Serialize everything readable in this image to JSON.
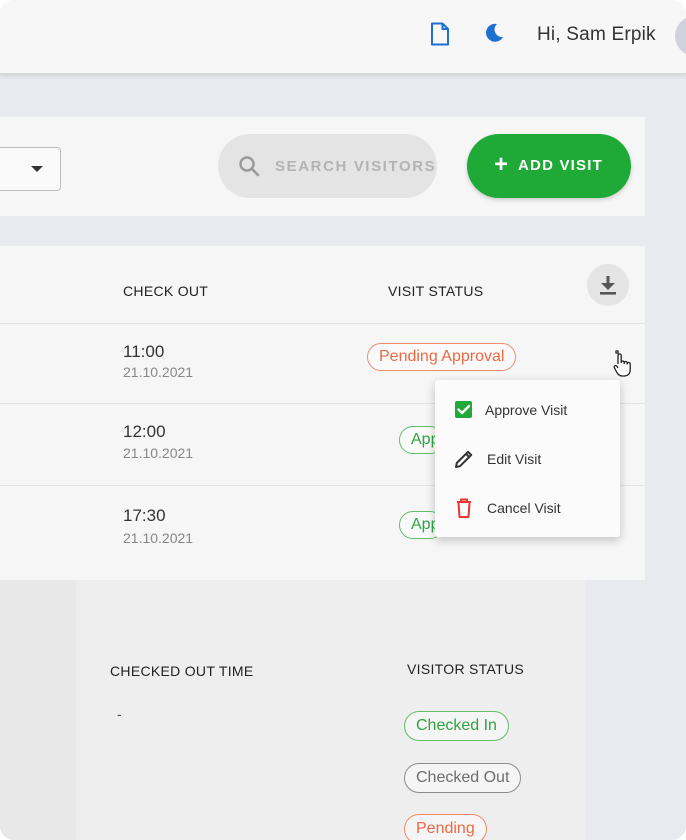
{
  "header": {
    "greeting": "Hi, Sam Erpik",
    "icons": [
      "document-icon",
      "moon-icon"
    ]
  },
  "toolbar": {
    "search_placeholder": "SEARCH VISITORS",
    "add_visit_label": "ADD VISIT",
    "add_visit_icon": "+"
  },
  "visits_table": {
    "columns": [
      "CHECK OUT",
      "VISIT STATUS"
    ],
    "rows": [
      {
        "check_out_time": "11:00",
        "check_out_date": "21.10.2021",
        "status": "Pending Approval"
      },
      {
        "check_out_time": "12:00",
        "check_out_date": "21.10.2021",
        "status": "Approved"
      },
      {
        "check_out_time": "17:30",
        "check_out_date": "21.10.2021",
        "status": "Approved"
      }
    ],
    "visible_status_text": [
      "Pending Approval",
      "App",
      "App"
    ]
  },
  "context_menu": {
    "items": [
      {
        "label": "Approve Visit",
        "icon": "checkbox-icon"
      },
      {
        "label": "Edit Visit",
        "icon": "pencil-icon"
      },
      {
        "label": "Cancel Visit",
        "icon": "trash-icon"
      }
    ]
  },
  "visitors_table": {
    "columns": [
      "CHECKED OUT TIME",
      "VISITOR STATUS"
    ],
    "checked_out_time": "-",
    "statuses": [
      "Checked In",
      "Checked Out",
      "Pending"
    ]
  },
  "colors": {
    "primary_green": "#1faa38",
    "pending_orange": "#ec6a43",
    "approved_green": "#2ea443",
    "icon_blue": "#1f6fd1",
    "danger_red": "#e53935"
  }
}
